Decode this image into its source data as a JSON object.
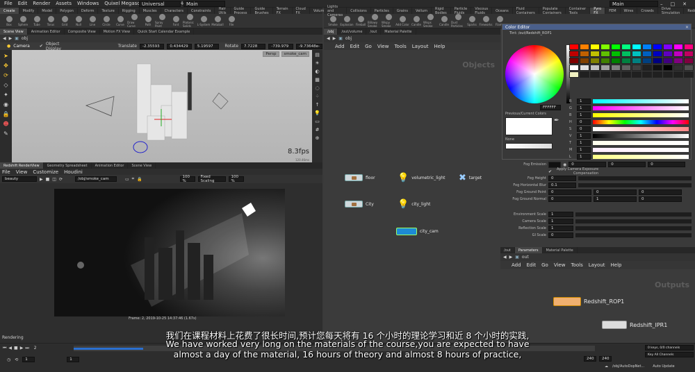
{
  "menu": [
    "File",
    "Edit",
    "Render",
    "Assets",
    "Windows",
    "Quixel Megascans",
    "Redshift",
    "Help"
  ],
  "desktop": "Universal",
  "main_label": "Main",
  "shelf_tabs_left": [
    "Create",
    "Modify",
    "Model",
    "Polygon",
    "Deform",
    "Texture",
    "Rigging",
    "Muscles",
    "Characters",
    "Constraints",
    "Hair Utils",
    "Guide Process",
    "Guide Brushes",
    "Terrain FX",
    "Cloud FX",
    "Volume"
  ],
  "shelf_tools_left": [
    "Box",
    "Sphere",
    "Tube",
    "Torus",
    "Grid",
    "Null",
    "Line",
    "Circle",
    "Curve",
    "Draw Curve",
    "Path",
    "Spray Paint",
    "Font",
    "Platonic Solids",
    "L-System",
    "Metaball",
    "File"
  ],
  "shelf_tabs_right": [
    "Lights and Cameras",
    "Collisions",
    "Particles",
    "Grains",
    "Vellum",
    "Rigid Bodies",
    "Particle Fluids",
    "Viscous Fluids",
    "Oceans",
    "Fluid Containers",
    "Populate Containers",
    "Container Tools",
    "Pyro FX",
    "FEM",
    "Wires",
    "Crowds",
    "Drive Simulation",
    "Redshift"
  ],
  "shelf_tools_right": [
    "Smoke",
    "Explosion",
    "Fireball",
    "Billowy Smoke",
    "Wispy Smoke",
    "Add Color",
    "Candle",
    "Wisps Smoke",
    "Candle",
    "Dust Particles",
    "Sparks",
    "Fireworks",
    "Flame"
  ],
  "viewport": {
    "tabs": [
      "Scene View",
      "Animation Editor",
      "Composite View",
      "Motion FX View",
      "Quick Start Calendar Example"
    ],
    "path": "obj",
    "camera_label": "Camera",
    "object_display": "Object Display",
    "translate_label": "Translate",
    "translate": [
      "-2.35593",
      "0.434429",
      "5.19597"
    ],
    "rotate_label": "Rotate",
    "rotate": [
      "7.7228",
      "-739.979",
      "-9.73648e-"
    ],
    "persp": "Persp",
    "cam": "smoke_cam",
    "fps": "8.3fps",
    "ms": "120.46ms"
  },
  "render_view": {
    "tabs": [
      "Redshift RenderView",
      "Geometry Spreadsheet",
      "Animation Editor",
      "Scene View"
    ],
    "menu": [
      "File",
      "View",
      "Customize",
      "Houdini"
    ],
    "aov": "beauty",
    "camera_path": "/obj/smoke_cam",
    "zoom": "100 %",
    "fixed_scaling": "Fixed Scaling",
    "zoom2": "100 %",
    "frame_info": "Frame: 2, 2019-10-25 14:37:46 (1.67s)",
    "status": "Rendering"
  },
  "network": {
    "tabs": [
      "/obj",
      "/out/volume",
      "/out",
      "Material Palette"
    ],
    "path": "obj",
    "menu": [
      "Add",
      "Edit",
      "Go",
      "View",
      "Tools",
      "Layout",
      "Help"
    ],
    "context": "Objects",
    "nodes": [
      {
        "name": "floor"
      },
      {
        "name": "volumetric_light"
      },
      {
        "name": "target"
      },
      {
        "name": "City"
      },
      {
        "name": "city_light"
      },
      {
        "name": "city_cam"
      }
    ]
  },
  "color_editor": {
    "title": "Color Editor",
    "path": "Tint: /out/Redshift_ROP1",
    "hex": "FFFFFF",
    "prev_label": "Previous/Current Colors",
    "none_label": "None",
    "channels": [
      "R",
      "G",
      "B",
      "H",
      "S",
      "V",
      "T",
      "M",
      "L"
    ],
    "values": [
      "1",
      "1",
      "1",
      "0",
      "0",
      "1",
      "1",
      "1",
      "1"
    ],
    "wheel_colors": [
      "#ff0000",
      "#ffff00",
      "#00ff00",
      "#00ffff",
      "#0000ff",
      "#ff00ff",
      "#ff0000"
    ],
    "swatches": [
      "#ff0000",
      "#ff8000",
      "#ffff00",
      "#80ff00",
      "#00ff00",
      "#00ff80",
      "#00ffff",
      "#0080ff",
      "#0000ff",
      "#8000ff",
      "#ff00ff",
      "#ff0080",
      "#c00000",
      "#c06000",
      "#c0c000",
      "#60c000",
      "#00c000",
      "#00c060",
      "#00c0c0",
      "#0060c0",
      "#0000c0",
      "#6000c0",
      "#c000c0",
      "#c00060",
      "#800000",
      "#804000",
      "#808000",
      "#408000",
      "#008000",
      "#008040",
      "#008080",
      "#004080",
      "#000080",
      "#400080",
      "#800080",
      "#800040",
      "#ffffff",
      "#e0e0e0",
      "#c0c0c0",
      "#a0a0a0",
      "#808080",
      "#606060",
      "#404040",
      "#202020",
      "#101010",
      "#000000",
      "#303030",
      "#505050",
      "#f0f0c0",
      "#202020",
      "#202020",
      "#202020",
      "#202020",
      "#202020",
      "#202020",
      "#202020",
      "#202020",
      "#202020",
      "#202020",
      "#202020"
    ]
  },
  "params": {
    "fog_emission": {
      "label": "Fog Emission",
      "values": [
        "0",
        "0",
        "0"
      ]
    },
    "apply_exposure": "Apply Camera Exposure Compensation",
    "rows": [
      {
        "label": "Fog Height",
        "values": [
          "0"
        ]
      },
      {
        "label": "Fog Horizontal Blur",
        "values": [
          "0.1"
        ]
      },
      {
        "label": "Fog Ground Point",
        "values": [
          "0",
          "0",
          "0"
        ]
      },
      {
        "label": "Fog Ground Normal",
        "values": [
          "0",
          "1",
          "0"
        ]
      }
    ],
    "scales": [
      {
        "label": "Environment Scale",
        "value": "1"
      },
      {
        "label": "Camera Scale",
        "value": "1"
      },
      {
        "label": "Reflection Scale",
        "value": "1"
      },
      {
        "label": "GI Scale",
        "value": "0"
      }
    ]
  },
  "out_network": {
    "tabs": [
      "/out",
      "Parameters",
      "Material Palette"
    ],
    "path": "out",
    "menu": [
      "Add",
      "Edit",
      "Go",
      "View",
      "Tools",
      "Layout",
      "Help"
    ],
    "context": "Outputs",
    "nodes": [
      {
        "name": "Redshift_ROP1"
      },
      {
        "name": "Redshift_IPR1"
      }
    ]
  },
  "timeline": {
    "frame": "2",
    "start": "1",
    "start2": "1",
    "end": "240",
    "end2": "240",
    "keys": "0 keys, 0/0 channels",
    "key_all": "Key All Channels",
    "auto_update": "Auto Update",
    "path_tag": "/obj/AutoDopNet..."
  },
  "subtitles": {
    "zh": "我们在课程材料上花费了很长时间,预计您每天将有 16 个小时的理论学习和近 8 个小时的实践,",
    "en1": "We have worked very long on the materials of the course,you are expected to have",
    "en2": "almost a day of the material, 16 hours of theory and almost 8 hours of practice,"
  }
}
